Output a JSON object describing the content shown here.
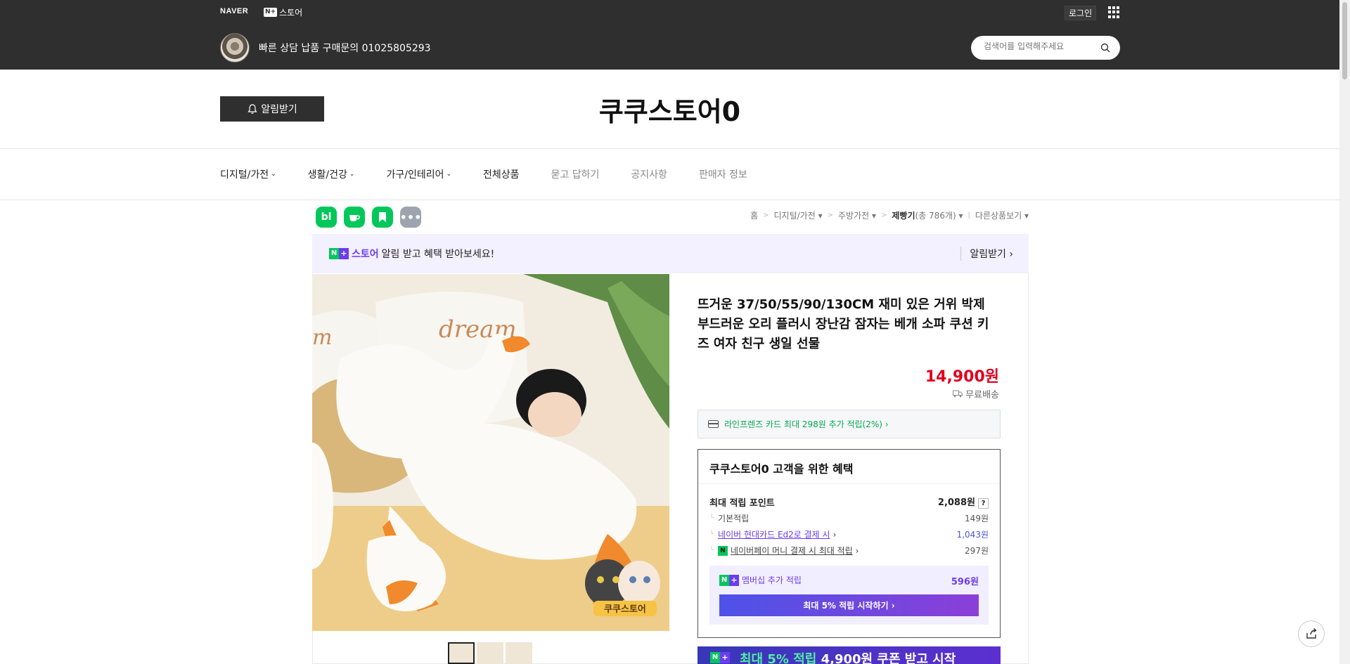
{
  "topbar": {
    "naver": "NAVER",
    "nplus_mark": "N+",
    "nplus_store": "스토어",
    "login": "로그인",
    "store_phone": "빠른 상담 납품 구매문의 01025805293",
    "search_placeholder": "검색어를 입력해주세요"
  },
  "header": {
    "alarm_button": "알림받기",
    "store_title": "쿠쿠스토어0"
  },
  "nav": {
    "items": [
      {
        "label": "디지털/가전",
        "chev": "⌄"
      },
      {
        "label": "생활/건강",
        "chev": "⌄"
      },
      {
        "label": "가구/인테리어",
        "chev": "⌄"
      },
      {
        "label": "전체상품"
      },
      {
        "label": "묻고 답하기"
      },
      {
        "label": "공지사항"
      },
      {
        "label": "판매자 정보"
      }
    ]
  },
  "social": {
    "blog": "bl",
    "more": "•••"
  },
  "breadcrumb": {
    "home": "홈",
    "c1": "디지털/가전",
    "c2": "주방가전",
    "c3": "제빵기",
    "count": "(총 786개)",
    "other": "다른상품보기"
  },
  "banner": {
    "brand": "스토어",
    "text": "알림 받고 혜택 받아보세요!",
    "right": "알림받기"
  },
  "product": {
    "title": "뜨거운 37/50/55/90/130CM 재미 있은 거위 박제 부드러운 오리 플러시 장난감 잠자는 베개 소파 쿠션 키즈 여자 친구 생일 선물",
    "price": "14,900원",
    "shipping": "무료배송",
    "image_watermark": "쿠쿠스토어"
  },
  "card_offer": "라인프렌즈 카드 최대 298원 추가 적립(2%) ›",
  "benefit": {
    "title": "쿠쿠스토어0 고객을 위한 혜택",
    "max_point_label": "최대 적립 포인트",
    "max_point_value": "2,088원",
    "qmark": "?",
    "basic_label": "기본적립",
    "basic_value": "149원",
    "card_label": "네이버 현대카드 Ed2로 결제 시",
    "card_value": "1,043원",
    "pay_label": "네이버페이 머니 결제 시 최대 적립",
    "pay_value": "297원",
    "npay_mark": "N",
    "membership_label": "멤버십 추가 적립",
    "membership_value": "596원",
    "membership_button": "최대 5% 적립 시작하기 ›"
  },
  "promo": {
    "highlight": "최대 5% 적립",
    "text": " 4,900원 쿠폰 받고 시작"
  },
  "colors": {
    "naver_green": "#03c75a",
    "plus_purple": "#6c3cf0",
    "price_red": "#e0001e",
    "topbar": "#2f2f2f"
  }
}
